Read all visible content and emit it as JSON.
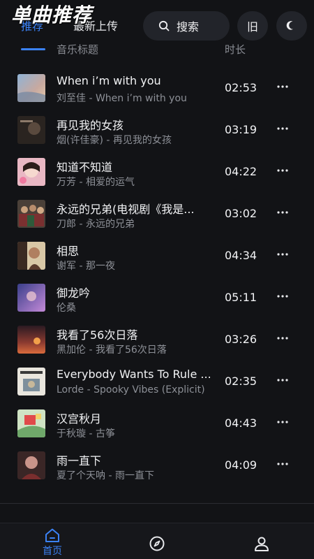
{
  "overlay_title": "单曲推荐",
  "header": {
    "tabs": [
      {
        "label": "推荐",
        "active": true
      },
      {
        "label": "最新上传",
        "active": false
      }
    ],
    "search_label": "搜索",
    "old_label": "旧",
    "accent_color": "#3b82f6"
  },
  "columns": {
    "title": "音乐标题",
    "duration": "时长"
  },
  "songs": [
    {
      "title": "When i’m with you",
      "subtitle": "刘至佳 - When i’m with you",
      "duration": "02:53"
    },
    {
      "title": "再见我的女孩",
      "subtitle": "烟(许佳豪) - 再见我的女孩",
      "duration": "03:19"
    },
    {
      "title": "知道不知道",
      "subtitle": "万芳 - 相爱的运气",
      "duration": "04:22"
    },
    {
      "title": "永远的兄弟(电视剧《我是...",
      "subtitle": "刀郎 - 永远的兄弟",
      "duration": "03:02"
    },
    {
      "title": "相思",
      "subtitle": "谢军 - 那一夜",
      "duration": "04:34"
    },
    {
      "title": "御龙吟",
      "subtitle": "伦桑",
      "duration": "05:11"
    },
    {
      "title": "我看了56次日落",
      "subtitle": "黑加伦 - 我看了56次日落",
      "duration": "03:26"
    },
    {
      "title": "Everybody Wants To Rule ...",
      "subtitle": "Lorde - Spooky Vibes (Explicit)",
      "duration": "02:35"
    },
    {
      "title": "汉宫秋月",
      "subtitle": "于秋璇 - 古筝",
      "duration": "04:43"
    },
    {
      "title": "雨一直下",
      "subtitle": "夏了个天呐 - 雨一直下",
      "duration": "04:09"
    }
  ],
  "bottom_nav": {
    "home_label": "首页"
  }
}
